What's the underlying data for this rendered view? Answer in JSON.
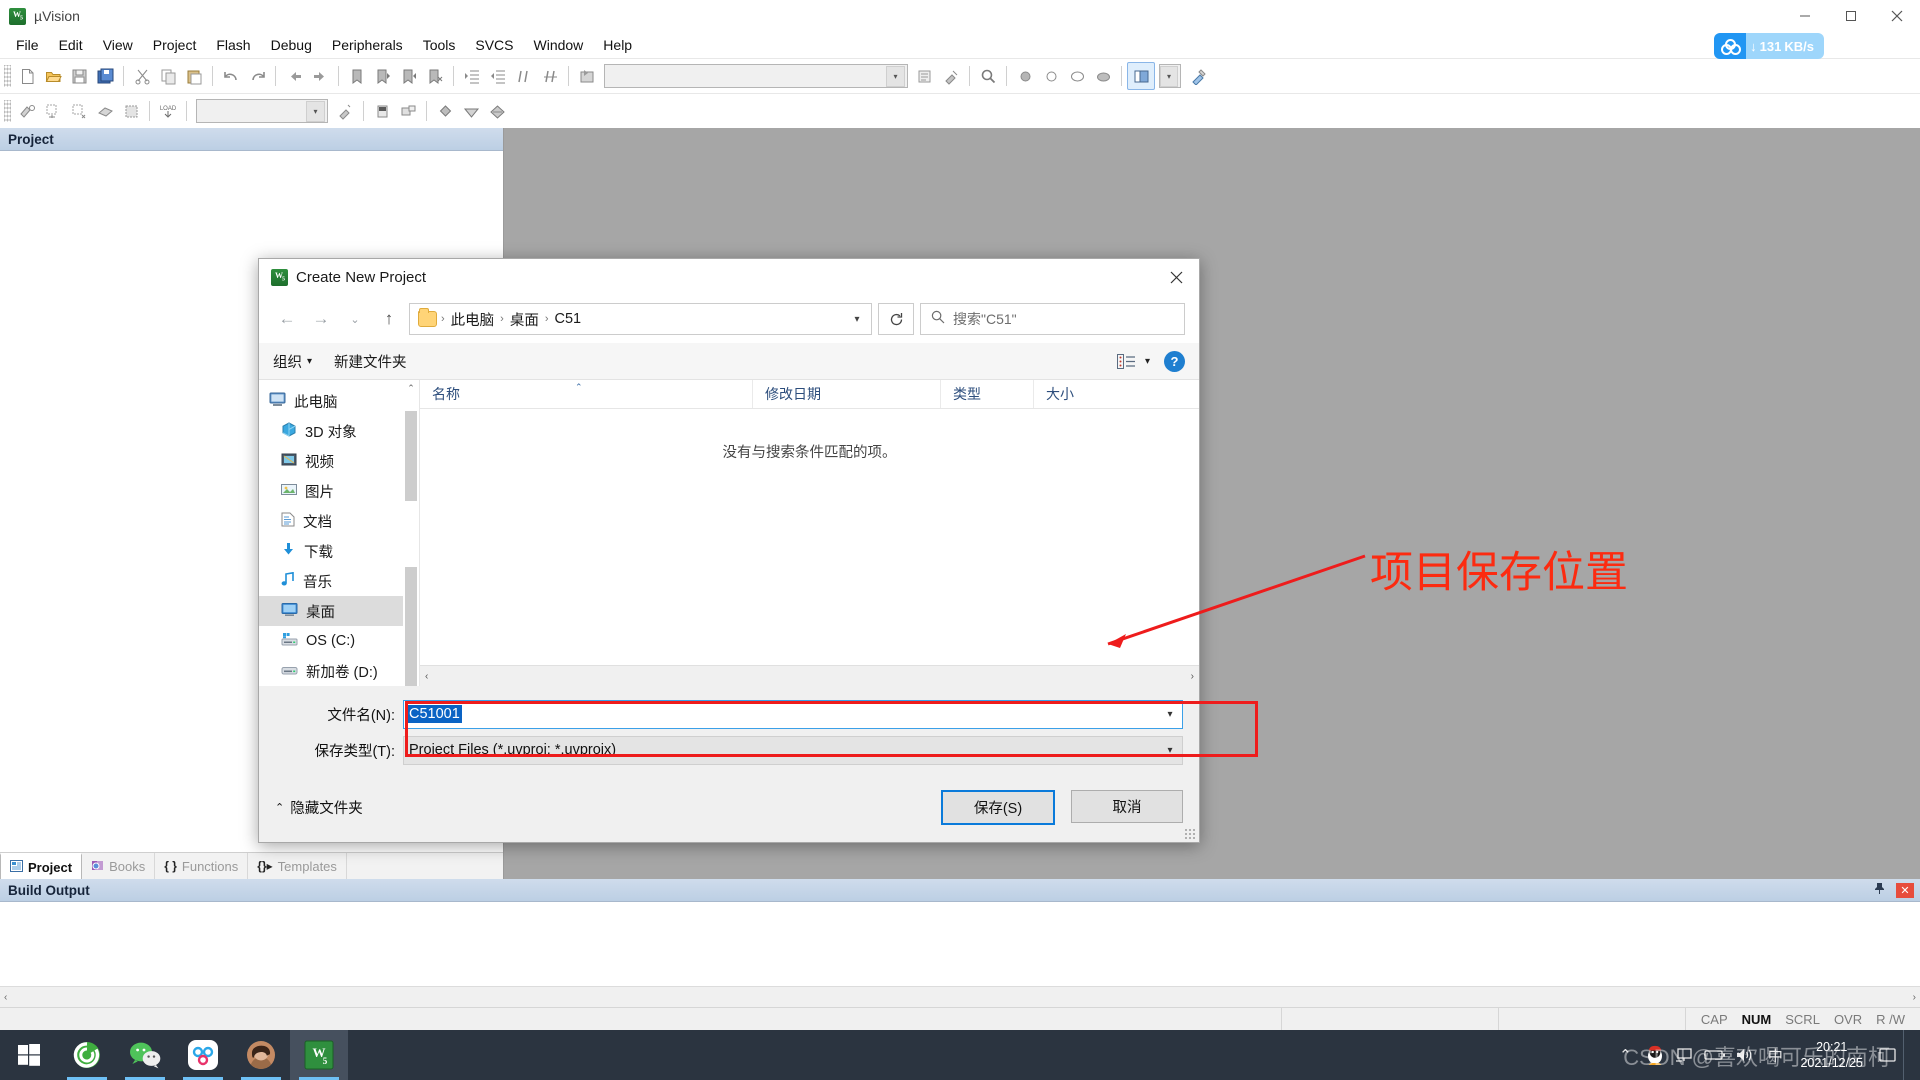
{
  "window": {
    "title": "µVision",
    "app_icon": "keil-uvision-icon",
    "minimize": "–",
    "maximize": "□",
    "close": "✕"
  },
  "menu": {
    "items": [
      "File",
      "Edit",
      "View",
      "Project",
      "Flash",
      "Debug",
      "Peripherals",
      "Tools",
      "SVCS",
      "Window",
      "Help"
    ]
  },
  "net_badge": {
    "icon": "baidu-netdisk-icon",
    "arrow": "↓",
    "speed": "131",
    "unit": "KB/s",
    "accent": "#2196f3"
  },
  "project_panel": {
    "header": "Project",
    "tabs": [
      {
        "label": "Project",
        "icon": "project-icon",
        "selected": true
      },
      {
        "label": "Books",
        "icon": "books-icon",
        "selected": false
      },
      {
        "label": "Functions",
        "icon": "functions-icon",
        "selected": false
      },
      {
        "label": "Templates",
        "icon": "templates-icon",
        "selected": false
      }
    ]
  },
  "build_output": {
    "header": "Build Output",
    "pin_icon": "pin-icon",
    "close_icon": "close-icon"
  },
  "status_bar": {
    "indicators": [
      {
        "label": "CAP",
        "active": false
      },
      {
        "label": "NUM",
        "active": true
      },
      {
        "label": "SCRL",
        "active": false
      },
      {
        "label": "OVR",
        "active": false
      },
      {
        "label": "R /W",
        "active": false
      }
    ]
  },
  "dialog": {
    "title": "Create New Project",
    "icon": "keil-uvision-icon",
    "close": "✕",
    "nav": {
      "back": "←",
      "forward": "→",
      "recent": "⌄",
      "up": "↑"
    },
    "breadcrumb": {
      "folder_icon": "folder-icon",
      "items": [
        "此电脑",
        "桌面",
        "C51"
      ],
      "separator": "›",
      "dropdown_icon": "chevron-down-icon"
    },
    "refresh_icon": "refresh-icon",
    "search": {
      "icon": "search-icon",
      "placeholder": "搜索\"C51\""
    },
    "command_bar": {
      "organize": "组织",
      "organize_caret": "▾",
      "new_folder": "新建文件夹",
      "view_icon": "view-list-icon",
      "view_caret": "▾",
      "help_icon": "help-icon",
      "help_label": "?"
    },
    "nav_pane": {
      "items": [
        {
          "label": "此电脑",
          "icon": "this-pc-icon",
          "root": true,
          "selected": false
        },
        {
          "label": "3D 对象",
          "icon": "3d-objects-icon",
          "root": false,
          "selected": false
        },
        {
          "label": "视频",
          "icon": "videos-icon",
          "root": false,
          "selected": false
        },
        {
          "label": "图片",
          "icon": "pictures-icon",
          "root": false,
          "selected": false
        },
        {
          "label": "文档",
          "icon": "documents-icon",
          "root": false,
          "selected": false
        },
        {
          "label": "下载",
          "icon": "downloads-icon",
          "root": false,
          "selected": false
        },
        {
          "label": "音乐",
          "icon": "music-icon",
          "root": false,
          "selected": false
        },
        {
          "label": "桌面",
          "icon": "desktop-icon",
          "root": false,
          "selected": true
        },
        {
          "label": "OS (C:)",
          "icon": "os-drive-icon",
          "root": false,
          "selected": false
        },
        {
          "label": "新加卷 (D:)",
          "icon": "drive-icon",
          "root": false,
          "selected": false
        }
      ],
      "scroll_up": "⌃",
      "scroll_down": "⌄"
    },
    "columns": [
      "名称",
      "修改日期",
      "类型",
      "大小"
    ],
    "empty_message": "没有与搜索条件匹配的项。",
    "scroll_left": "‹",
    "scroll_right": "›",
    "form": {
      "filename_label": "文件名(N):",
      "filename_value": "C51001",
      "filetype_label": "保存类型(T):",
      "filetype_value": "Project Files (*.uvproj; *.uvprojx)",
      "dropdown_icon": "chevron-down-icon"
    },
    "hide_folders": {
      "caret": "⌃",
      "label": "隐藏文件夹"
    },
    "buttons": {
      "save": "保存(S)",
      "cancel": "取消"
    }
  },
  "annotation": {
    "text": "项目保存位置",
    "color": "#fc2b10",
    "highlight_color": "#ee1c1c"
  },
  "taskbar": {
    "items": [
      {
        "icon": "windows-start-icon",
        "running": false,
        "focused": false
      },
      {
        "icon": "360-browser-icon",
        "running": true,
        "focused": false
      },
      {
        "icon": "wechat-icon",
        "running": true,
        "focused": false
      },
      {
        "icon": "baidu-netdisk-icon",
        "running": true,
        "focused": false
      },
      {
        "icon": "user-avatar-icon",
        "running": true,
        "focused": false
      },
      {
        "icon": "keil-uvision-icon",
        "running": true,
        "focused": true
      }
    ],
    "tray": {
      "expand": "⌃",
      "icons": [
        "qq-icon",
        "network-icon",
        "battery-icon",
        "volume-icon",
        "ime-icon"
      ],
      "ime_label": "中",
      "time": "20:21",
      "date": "2021/12/25",
      "notification_icon": "notification-icon"
    }
  },
  "watermark": {
    "text": "CSDN @喜欢喝可乐的南柯"
  }
}
